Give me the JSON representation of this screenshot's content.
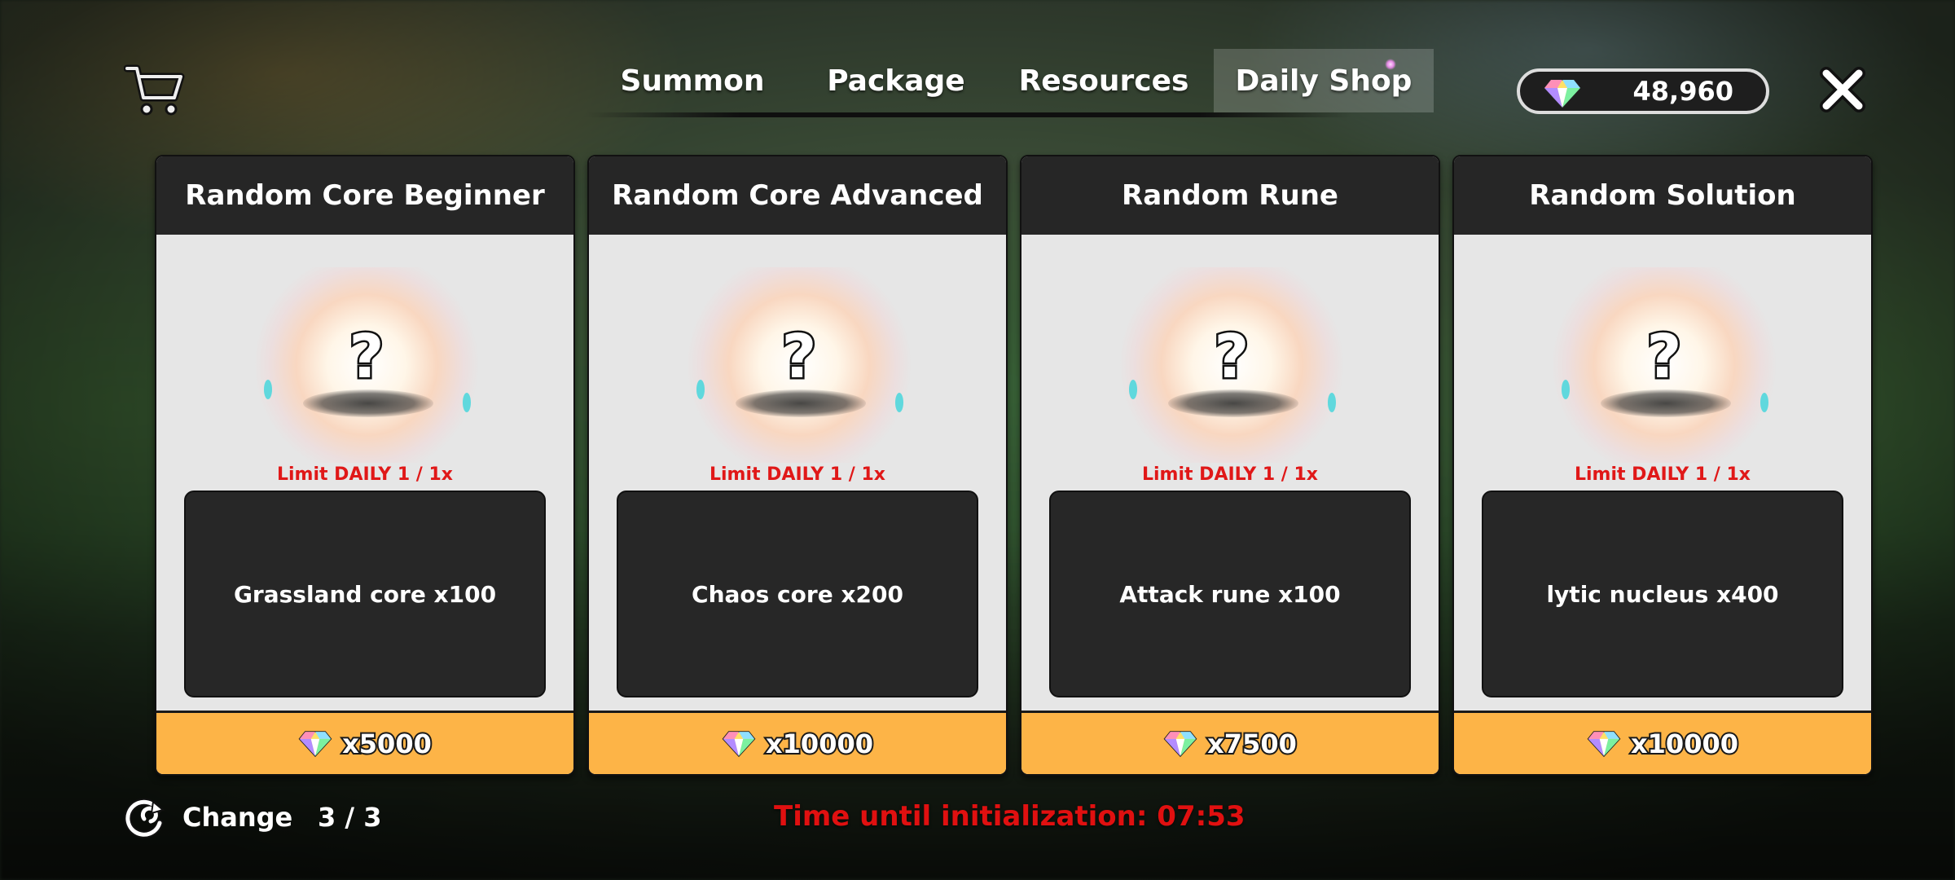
{
  "tabs": [
    {
      "label": "Summon",
      "active": false
    },
    {
      "label": "Package",
      "active": false
    },
    {
      "label": "Resources",
      "active": false
    },
    {
      "label": "Daily Shop",
      "active": true
    }
  ],
  "currency": {
    "amount": "48,960",
    "icon": "gem-icon"
  },
  "icons": {
    "cart": "shopping-cart-icon",
    "close": "close-icon",
    "change": "refresh-icon"
  },
  "cards": [
    {
      "title": "Random Core Beginner",
      "limit": "Limit DAILY 1 / 1x",
      "item": "Grassland core x100",
      "price": "x5000"
    },
    {
      "title": "Random Core Advanced",
      "limit": "Limit DAILY 1 / 1x",
      "item": "Chaos core x200",
      "price": "x10000"
    },
    {
      "title": "Random Rune",
      "limit": "Limit DAILY 1 / 1x",
      "item": "Attack rune x100",
      "price": "x7500"
    },
    {
      "title": "Random Solution",
      "limit": "Limit DAILY 1 / 1x",
      "item": "lytic nucleus x400",
      "price": "x10000"
    }
  ],
  "footer": {
    "change_label": "Change",
    "change_count": "3 / 3",
    "timer": "Time until initialization: 07:53"
  },
  "colors": {
    "buy_button": "#fdb447",
    "limit_text": "#e01818",
    "timer_text": "#e01010"
  }
}
